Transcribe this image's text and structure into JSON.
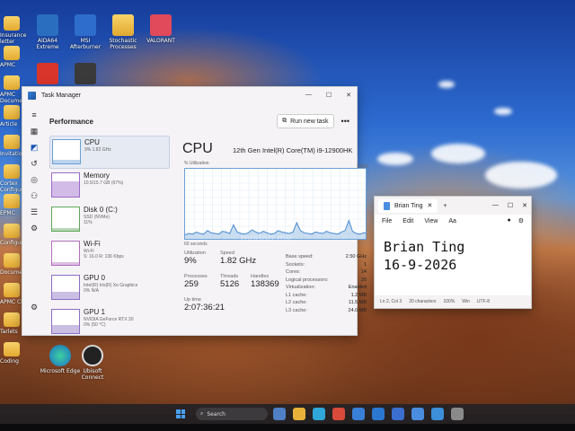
{
  "desktop": {
    "icons_top": [
      {
        "label": "AIDA64 Extreme",
        "icon": "aida64-icon",
        "color": "#2a6fbf"
      },
      {
        "label": "MSI Afterburner",
        "icon": "msi-afterburner-icon",
        "color": "#2f6dcc"
      },
      {
        "label": "Stochastic Processes",
        "icon": "folder-icon",
        "color": "#e8b23a"
      },
      {
        "label": "VALORANT",
        "icon": "valorant-icon",
        "color": "#e14a5a"
      }
    ],
    "left_edge_labels": [
      "Insurance letter",
      "APMC",
      "APMC Documents",
      "Article",
      "Invitation",
      "Cortex Configure",
      "EPMC",
      "Configure",
      "Document",
      "APMC CRI",
      "Tarlets",
      "Coding"
    ],
    "icons_bottom": [
      {
        "label": "Microsoft Edge",
        "icon": "edge-icon"
      },
      {
        "label": "Ubisoft Connect",
        "icon": "ubisoft-icon"
      }
    ]
  },
  "task_manager": {
    "window_title": "Task Manager",
    "section_title": "Performance",
    "run_new_task": "Run new task",
    "more": "•••",
    "items": [
      {
        "name": "CPU",
        "sub1": "9%  1.82 GHz",
        "sub2": "",
        "color": "#6aa0d6",
        "level": 0.15
      },
      {
        "name": "Memory",
        "sub1": "10.5/15.7 GB (67%)",
        "sub2": "",
        "color": "#9b6ac9",
        "level": 0.67
      },
      {
        "name": "Disk 0 (C:)",
        "sub1": "SSD (NVMe)",
        "sub2": "11%",
        "color": "#5ea65a",
        "level": 0.11
      },
      {
        "name": "Wi-Fi",
        "sub1": "Wi-Fi",
        "sub2": "S: 16.0  R: 136 Kbps",
        "color": "#b26fbd",
        "level": 0.1
      },
      {
        "name": "GPU 0",
        "sub1": "Intel(R) Iris(R) Xe Graphics",
        "sub2": "0% N/A",
        "color": "#8a6fc2",
        "level": 0.3
      },
      {
        "name": "GPU 1",
        "sub1": "NVIDIA GeForce RTX 30",
        "sub2": "0% (50 °C)",
        "color": "#8a6fc2",
        "level": 0.35
      }
    ],
    "cpu": {
      "title": "CPU",
      "model": "12th Gen Intel(R) Core(TM) i9-12900HK",
      "utilization_label": "% Utilization",
      "max_label": "100%",
      "seconds_label": "60 seconds",
      "utilization_history": [
        8,
        10,
        9,
        12,
        10,
        9,
        14,
        11,
        10,
        9,
        13,
        12,
        10,
        22,
        12,
        10,
        9,
        11,
        15,
        12,
        10,
        13,
        11,
        9,
        10,
        14,
        12,
        11,
        10,
        12,
        25,
        14,
        11,
        10,
        9,
        12,
        11,
        10,
        13,
        11,
        10,
        9,
        12,
        14,
        28,
        13,
        10,
        9,
        11,
        10
      ],
      "stats": [
        {
          "k": "Utilization",
          "v": "9%"
        },
        {
          "k": "Speed",
          "v": "1.82 GHz"
        },
        {
          "k": "Processes",
          "v": "259"
        },
        {
          "k": "Threads",
          "v": "5126"
        },
        {
          "k": "Handles",
          "v": "138369"
        },
        {
          "k": "Up time",
          "v": "2:07:36:21"
        }
      ],
      "specs": [
        {
          "k": "Base speed:",
          "v": "2.50 GHz"
        },
        {
          "k": "Sockets:",
          "v": "1"
        },
        {
          "k": "Cores:",
          "v": "14"
        },
        {
          "k": "Logical processors:",
          "v": "20"
        },
        {
          "k": "Virtualization:",
          "v": "Enabled"
        },
        {
          "k": "L1 cache:",
          "v": "1.2 MB"
        },
        {
          "k": "L2 cache:",
          "v": "11.5 MB"
        },
        {
          "k": "L3 cache:",
          "v": "24.0 MB"
        }
      ]
    }
  },
  "notepad": {
    "tab_title": "Brian Ting",
    "plus": "+",
    "menu": [
      "File",
      "Edit",
      "View"
    ],
    "line1": "Brian Ting",
    "line2": "16-9-2026",
    "status": [
      "Ln 2, Col 3",
      "20 characters",
      "100%",
      "Win",
      "UTF-8"
    ]
  },
  "taskbar": {
    "search_placeholder": "Search",
    "apps": [
      {
        "icon": "widgets-icon",
        "color": "#4f7fc4"
      },
      {
        "icon": "file-explorer-icon",
        "color": "#e8b23a"
      },
      {
        "icon": "edge-icon",
        "color": "#2fa7d8"
      },
      {
        "icon": "chrome-icon",
        "color": "#d94a3a"
      },
      {
        "icon": "store-icon",
        "color": "#3a7fd6"
      },
      {
        "icon": "mail-icon",
        "color": "#2a78d2"
      },
      {
        "icon": "photos-icon",
        "color": "#3b6fcf"
      },
      {
        "icon": "task-manager-icon",
        "color": "#4a8de0"
      },
      {
        "icon": "notepad-icon",
        "color": "#3c8fd8"
      },
      {
        "icon": "alienware-icon",
        "color": "#8a8a8a"
      }
    ]
  },
  "watermark": "mudah.my"
}
